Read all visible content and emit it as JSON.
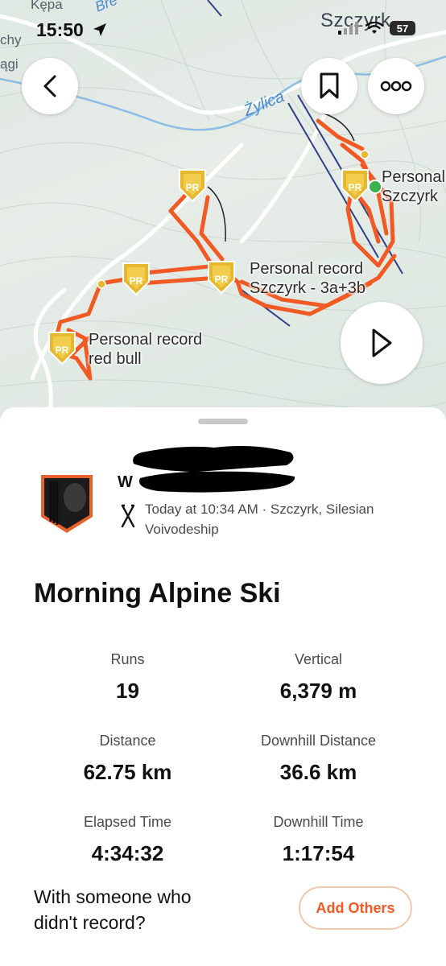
{
  "status_bar": {
    "time": "15:50",
    "battery": "57"
  },
  "map": {
    "place_labels": [
      "Kępa",
      "chy",
      "ągi",
      "Bre"
    ],
    "river_label": "Żylica",
    "town_label": "Szczyrk",
    "badge_text": "PR",
    "pr_labels": [
      {
        "line1": "Personal",
        "line2": "Szczyrk"
      },
      {
        "line1": "Personal record",
        "line2": "Szczyrk - 3a+3b"
      },
      {
        "line1": "Personal record",
        "line2": "red bull"
      }
    ],
    "route_color": "#f15a24",
    "badge_color": "#e6b82e",
    "icons": {
      "back": "chevron-left-icon",
      "bookmark": "bookmark-icon",
      "more": "more-dots-icon",
      "play": "play-icon"
    }
  },
  "activity": {
    "athlete_name_visible": "W",
    "meta": "Today at 10:34 AM · Szczyrk, Silesian Voivodeship",
    "title": "Morning Alpine Ski",
    "stats": [
      {
        "label": "Runs",
        "value": "19"
      },
      {
        "label": "Vertical",
        "value": "6,379 m"
      },
      {
        "label": "Distance",
        "value": "62.75 km"
      },
      {
        "label": "Downhill Distance",
        "value": "36.6 km"
      },
      {
        "label": "Elapsed Time",
        "value": "4:34:32"
      },
      {
        "label": "Downhill Time",
        "value": "1:17:54"
      }
    ],
    "with_others_text": "With someone who didn't record?",
    "add_others_label": "Add Others"
  },
  "colors": {
    "accent": "#f15a24",
    "accent_border": "#f3c7b0"
  }
}
